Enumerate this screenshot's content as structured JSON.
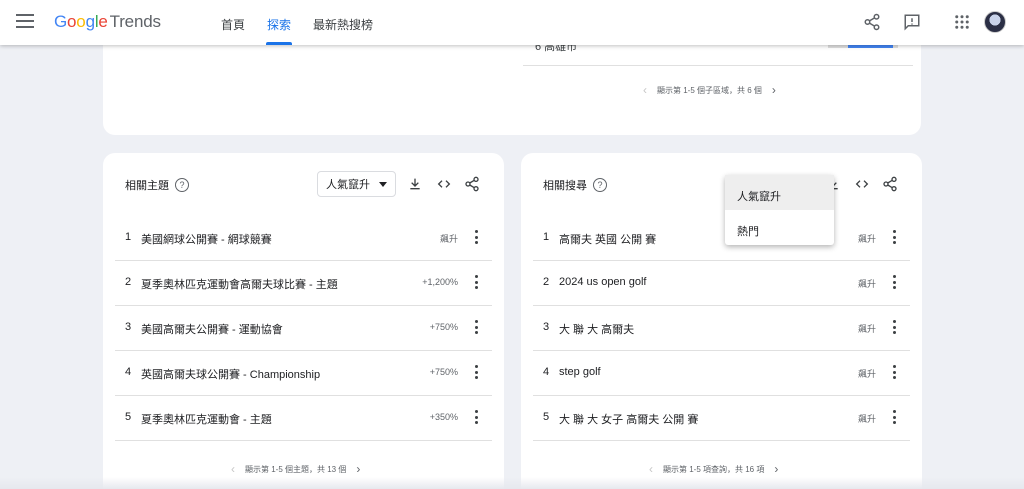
{
  "header": {
    "logo_google": [
      "G",
      "o",
      "o",
      "g",
      "l",
      "e"
    ],
    "logo_trends": "Trends",
    "nav": [
      {
        "label": "首頁",
        "active": false
      },
      {
        "label": "探索",
        "active": true
      },
      {
        "label": "最新熱搜榜",
        "active": false
      }
    ],
    "icons": [
      "menu-icon",
      "share-icon",
      "feedback-icon",
      "apps-icon",
      "avatar"
    ]
  },
  "top_card": {
    "partial_row_text": "6   高雄市",
    "pager_text": "顯示第 1-5 個子區域，共 6 個"
  },
  "related_topics": {
    "title": "相關主題",
    "help": "?",
    "select_value": "人氣竄升",
    "rows": [
      {
        "rank": "1",
        "label": "美國網球公開賽 - 網球競賽",
        "value": "飆升"
      },
      {
        "rank": "2",
        "label": "夏季奧林匹克運動會高爾夫球比賽 - 主題",
        "value": "+1,200%"
      },
      {
        "rank": "3",
        "label": "美國高爾夫公開賽 - 運動協會",
        "value": "+750%"
      },
      {
        "rank": "4",
        "label": "英國高爾夫球公開賽 - Championship",
        "value": "+750%"
      },
      {
        "rank": "5",
        "label": "夏季奧林匹克運動會 - 主題",
        "value": "+350%"
      }
    ],
    "pager_text": "顯示第 1-5 個主題，共 13 個"
  },
  "related_queries": {
    "title": "相關搜尋",
    "help": "?",
    "rows": [
      {
        "rank": "1",
        "label": "高爾夫 英國 公開 賽",
        "value": "飆升"
      },
      {
        "rank": "2",
        "label": "2024 us open golf",
        "value": "飆升"
      },
      {
        "rank": "3",
        "label": "大 聯 大 高爾夫",
        "value": "飆升"
      },
      {
        "rank": "4",
        "label": "step golf",
        "value": "飆升"
      },
      {
        "rank": "5",
        "label": "大 聯 大 女子 高爾夫 公開 賽",
        "value": "飆升"
      }
    ],
    "pager_text": "顯示第 1-5 項查詢，共 16 項",
    "dropdown_options": [
      "人氣竄升",
      "熱門"
    ]
  },
  "colors": {
    "accent": "#1a73e8",
    "bar": "#4285f4"
  }
}
